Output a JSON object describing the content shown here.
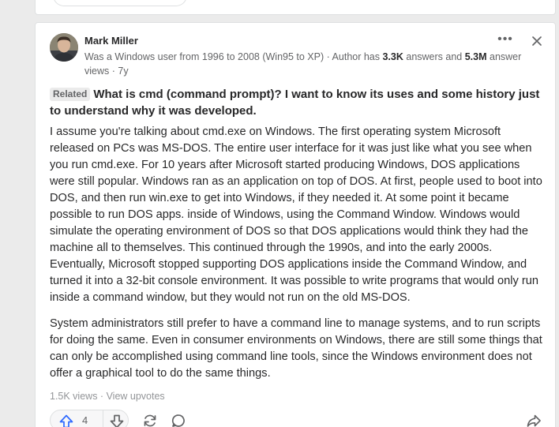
{
  "answer_card": {
    "author_name": "Mark Miller",
    "credential_text": "Was a Windows user from 1996 to 2008 (Win95 to XP) · Author has ",
    "answers_count": "3.3K",
    "answers_text": " answers and ",
    "views_count": "5.3M",
    "views_text": " answer views · 7y",
    "related_tag": "Related",
    "related_question": "What is cmd (command prompt)? I want to know its uses and some history just to understand why it was developed.",
    "paragraphs": [
      "I assume you're talking about cmd.exe on Windows. The first operating system Microsoft released on PCs was MS-DOS. The entire user interface for it was just like what you see when you run cmd.exe. For 10 years after Microsoft started producing Windows, DOS applications were still popular. Windows ran as an application on top of DOS. At first, people used to boot into DOS, and then run win.exe to get into Windows, if they needed it. At some point it became possible to run DOS apps. inside of Windows, using the Command Window. Windows would simulate the operating environment of DOS so that DOS applications would think they had the machine all to themselves. This continued through the 1990s, and into the early 2000s. Eventually, Microsoft stopped supporting DOS applications inside the Command Window, and turned it into a 32-bit console environment. It was possible to write programs that would only run inside a command window, but they would not run on the old MS-DOS.",
      "System administrators still prefer to have a command line to manage systems, and to run scripts for doing the same. Even in consumer environments on Windows, there are still some things that can only be accomplished using command line tools, since the Windows environment does not offer a graphical tool to do the same things."
    ],
    "view_count": "1.5K views",
    "meta_sep": " · ",
    "view_upvotes": "View upvotes",
    "upvote_count": "4",
    "more_label": "•••"
  },
  "icons": {
    "more": "more-horizontal-icon",
    "close": "close-icon",
    "upvote": "upvote-arrow-icon",
    "downvote": "downvote-arrow-icon",
    "share": "reshare-icon",
    "comment": "comment-icon",
    "forward": "share-forward-icon"
  },
  "colors": {
    "accent": "#2e69ff",
    "text": "#282829",
    "muted": "#636466",
    "background": "#ebebeb"
  }
}
